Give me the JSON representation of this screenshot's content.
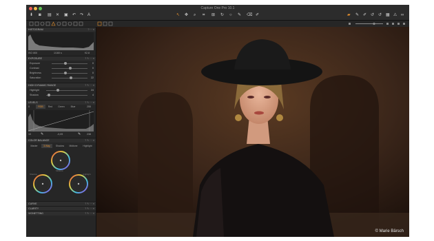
{
  "window": {
    "title": "Capture One Pro 10.1"
  },
  "icons": {
    "toolbar_left": [
      "import-icon",
      "camera-icon",
      "browser-icon",
      "delete-icon",
      "rotate-icon",
      "undo-icon",
      "redo-icon",
      "text-icon"
    ],
    "toolbar_center": [
      "cursor-tool-icon",
      "pan-tool-icon",
      "loupe-tool-icon",
      "crop-tool-icon",
      "keystone-tool-icon",
      "rotate-tool-icon",
      "spot-tool-icon",
      "brush-tool-icon",
      "eraser-tool-icon",
      "picker-tool-icon"
    ],
    "toolbar_right": [
      "folder-icon",
      "copy-icon",
      "apply-icon",
      "reset-icon",
      "undo-all-icon",
      "grid-icon",
      "print-icon",
      "proof-icon"
    ]
  },
  "histogram": {
    "title": "HISTOGRAM",
    "iso": "ISO 800",
    "shutter": "1/160 s",
    "aperture": "f/2.8"
  },
  "exposure": {
    "title": "EXPOSURE",
    "rows": [
      {
        "label": "Exposure",
        "value": "0"
      },
      {
        "label": "Contrast",
        "value": "0"
      },
      {
        "label": "Brightness",
        "value": "0"
      },
      {
        "label": "Saturation",
        "value": "22"
      }
    ]
  },
  "hdr": {
    "title": "HIGH DYNAMIC RANGE",
    "rows": [
      {
        "label": "Highlight",
        "value": "24"
      },
      {
        "label": "Shadow",
        "value": "4"
      }
    ]
  },
  "levels": {
    "title": "LEVELS",
    "min_left": "0",
    "max_right": "255",
    "tabs": [
      "RGB",
      "Red",
      "Green",
      "Blue"
    ],
    "low": "10",
    "mid": "-0,09",
    "high": "238"
  },
  "color_balance": {
    "title": "COLOR BALANCE",
    "tabs": [
      "Master",
      "3-Way",
      "Shadow",
      "Midtone",
      "Highlight"
    ],
    "wheels": [
      "Midtone",
      "Shadow",
      "Highlight"
    ]
  },
  "collapsed": [
    "CURVE",
    "CLARITY",
    "VIGNETTING"
  ],
  "photo": {
    "credit": "© Marie Bärsch"
  }
}
